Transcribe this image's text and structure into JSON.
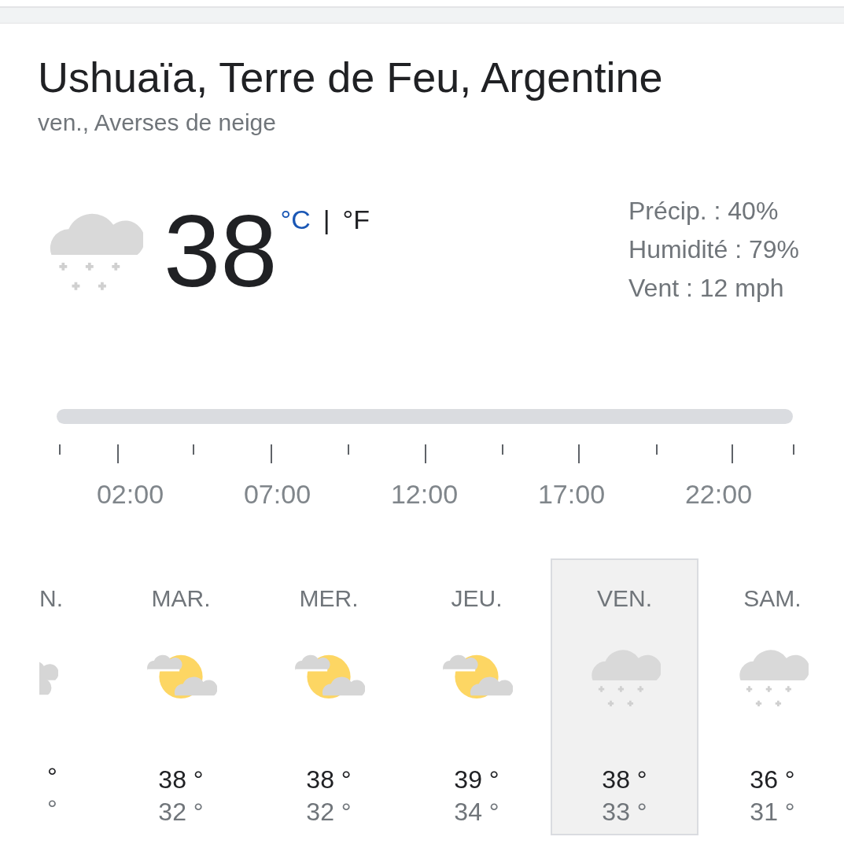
{
  "location": {
    "title": "Ushuaïa, Terre de Feu, Argentine",
    "subtitle": "ven., Averses de neige"
  },
  "current": {
    "kind": "snow",
    "temperature": "38",
    "units": [
      {
        "label": "°C",
        "selected": false
      },
      {
        "label": "°F",
        "selected": true
      }
    ],
    "unit_separator": "|",
    "details": [
      "Précip. : 40%",
      "Humidité : 79%",
      "Vent : 12 mph"
    ]
  },
  "timeline": {
    "labels": [
      "02:00",
      "07:00",
      "12:00",
      "17:00",
      "22:00"
    ]
  },
  "days": [
    {
      "name": "N.",
      "kind": "cloudy",
      "high": "°",
      "low": "°",
      "selected": false,
      "cut": true
    },
    {
      "name": "MAR.",
      "kind": "partly",
      "high": "38 °",
      "low": "32 °",
      "selected": false
    },
    {
      "name": "MER.",
      "kind": "partly",
      "high": "38 °",
      "low": "32 °",
      "selected": false
    },
    {
      "name": "JEU.",
      "kind": "partly",
      "high": "39 °",
      "low": "34 °",
      "selected": false
    },
    {
      "name": "VEN.",
      "kind": "snow",
      "high": "38 °",
      "low": "33 °",
      "selected": true
    },
    {
      "name": "SAM.",
      "kind": "snow",
      "high": "36 °",
      "low": "31 °",
      "selected": false
    }
  ]
}
